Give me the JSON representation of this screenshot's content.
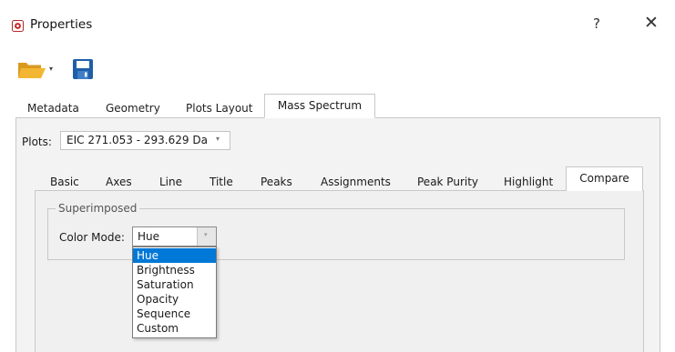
{
  "window": {
    "title": "Properties",
    "help_label": "?",
    "close_label": "✕",
    "icon": "app-icon"
  },
  "toolbar": {
    "open_icon": "folder-open-icon",
    "dropdown_label": "▾",
    "save_icon": "save-icon"
  },
  "main_tabs": [
    {
      "label": "Metadata"
    },
    {
      "label": "Geometry"
    },
    {
      "label": "Plots Layout"
    },
    {
      "label": "Mass Spectrum",
      "active": true
    }
  ],
  "plots": {
    "label": "Plots:",
    "value": "EIC 271.053 - 293.629 Da",
    "arrow": "▾"
  },
  "sub_tabs": [
    {
      "label": "Basic"
    },
    {
      "label": "Axes"
    },
    {
      "label": "Line"
    },
    {
      "label": "Title"
    },
    {
      "label": "Peaks"
    },
    {
      "label": "Assignments"
    },
    {
      "label": "Peak Purity"
    },
    {
      "label": "Highlight"
    },
    {
      "label": "Compare",
      "active": true
    }
  ],
  "superimposed": {
    "title": "Superimposed",
    "color_mode_label": "Color Mode:",
    "color_mode_value": "Hue",
    "arrow": "▾",
    "options": [
      "Hue",
      "Brightness",
      "Saturation",
      "Opacity",
      "Sequence",
      "Custom"
    ],
    "selected_option": "Hue"
  },
  "colors": {
    "selection": "#0078d7",
    "folder": "#f2b632",
    "save": "#1f5ea8"
  }
}
